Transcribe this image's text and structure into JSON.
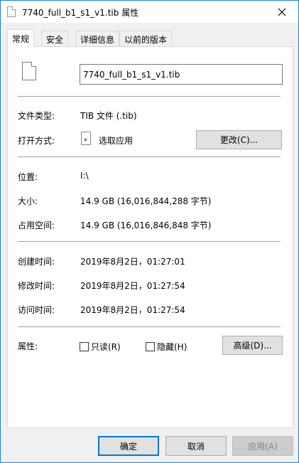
{
  "window": {
    "title": "7740_full_b1_s1_v1.tib 属性"
  },
  "tabs": [
    {
      "label": "常规",
      "active": true
    },
    {
      "label": "安全",
      "active": false
    },
    {
      "label": "详细信息",
      "active": false
    },
    {
      "label": "以前的版本",
      "active": false
    }
  ],
  "general": {
    "file_name": "7740_full_b1_s1_v1.tib",
    "type_label": "文件类型:",
    "type_value": "TIB 文件 (.tib)",
    "opens_with_label": "打开方式:",
    "opens_with_value": "选取应用",
    "change_button": "更改(C)...",
    "location_label": "位置:",
    "location_value": "I:\\",
    "size_label": "大小:",
    "size_value": "14.9 GB (16,016,844,288 字节)",
    "size_on_disk_label": "占用空间:",
    "size_on_disk_value": "14.9 GB (16,016,846,848 字节)",
    "created_label": "创建时间:",
    "created_value": "2019年8月2日，01:27:01",
    "modified_label": "修改时间:",
    "modified_value": "2019年8月2日，01:27:54",
    "accessed_label": "访问时间:",
    "accessed_value": "2019年8月2日，01:27:54",
    "attributes_label": "属性:",
    "readonly_label": "只读(R)",
    "readonly_checked": false,
    "hidden_label": "隐藏(H)",
    "hidden_checked": false,
    "advanced_button": "高级(D)..."
  },
  "footer": {
    "ok": "确定",
    "cancel": "取消",
    "apply": "应用(A)"
  }
}
